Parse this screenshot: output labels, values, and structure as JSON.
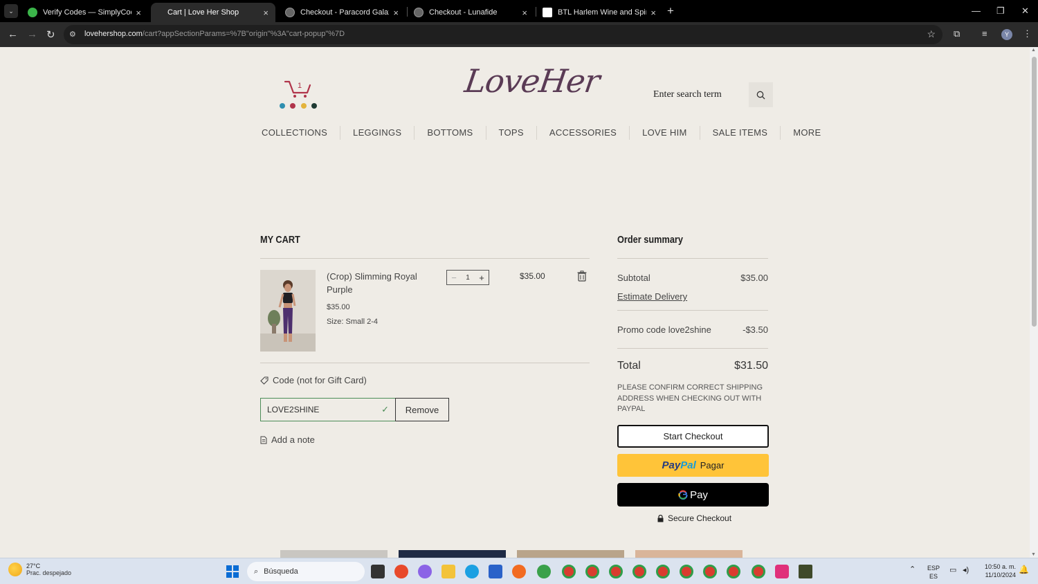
{
  "browser": {
    "tabs": [
      {
        "title": "Verify Codes — SimplyCodes",
        "active": false
      },
      {
        "title": "Cart | Love Her Shop",
        "active": true
      },
      {
        "title": "Checkout - Paracord Galaxy",
        "active": false
      },
      {
        "title": "Checkout - Lunafide",
        "active": false
      },
      {
        "title": "BTL Harlem Wine and Spirits , H",
        "active": false
      }
    ],
    "url_host": "lovehershop.com",
    "url_path": "/cart?appSectionParams=%7B\"origin\"%3A\"cart-popup\"%7D",
    "profile_initial": "Y"
  },
  "header": {
    "cart_count": "1",
    "logo_text": "LoveHer",
    "search_placeholder": "Enter search term"
  },
  "nav": [
    "COLLECTIONS",
    "LEGGINGS",
    "BOTTOMS",
    "TOPS",
    "ACCESSORIES",
    "LOVE HIM",
    "SALE ITEMS",
    "MORE"
  ],
  "cart": {
    "heading": "MY CART",
    "item": {
      "name": "(Crop) Slimming Royal Purple",
      "unit_price": "$35.00",
      "size": "Size: Small 2-4",
      "quantity": "1",
      "line_total": "$35.00"
    },
    "code_label": "Code (not for Gift Card)",
    "code_value": "LOVE2SHINE",
    "remove_label": "Remove",
    "note_label": "Add a note"
  },
  "summary": {
    "heading": "Order summary",
    "subtotal_label": "Subtotal",
    "subtotal_value": "$35.00",
    "estimate_label": "Estimate Delivery",
    "promo_label": "Promo code love2shine",
    "promo_value": "-$3.50",
    "total_label": "Total",
    "total_value": "$31.50",
    "notice": "PLEASE CONFIRM CORRECT SHIPPING ADDRESS WHEN CHECKING OUT WITH PAYPAL",
    "checkout_label": "Start Checkout",
    "paypal_brand_1": "Pay",
    "paypal_brand_2": "Pal",
    "paypal_label": "Pagar",
    "gpay_label": "Pay",
    "secure_label": "Secure Checkout"
  },
  "taskbar": {
    "temp": "27°C",
    "weather": "Prac. despejado",
    "search_label": "Búsqueda",
    "lang_1": "ESP",
    "lang_2": "ES",
    "time": "10:50 a. m.",
    "date": "11/10/2024"
  },
  "colors": {
    "brand_plum": "#5a3b55",
    "page_bg": "#efece6",
    "paypal_yellow": "#ffc439",
    "code_green": "#4b8c57"
  }
}
